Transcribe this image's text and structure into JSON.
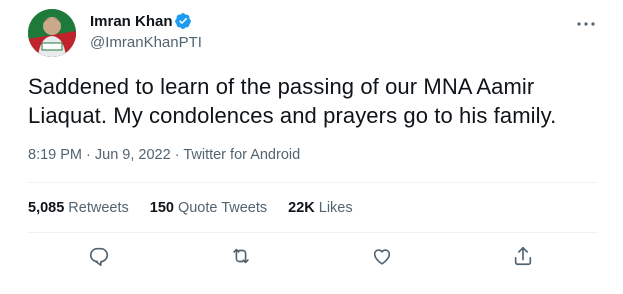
{
  "author": {
    "name": "Imran Khan",
    "handle": "@ImranKhanPTI",
    "verified": true,
    "verified_color": "#1d9bf0"
  },
  "tweet": {
    "text": "Saddened to learn of the passing of our MNA Aamir Liaquat. My condolences and prayers go to his family."
  },
  "meta": {
    "time": "8:19 PM",
    "sep1": " · ",
    "date": "Jun 9, 2022",
    "sep2": " · ",
    "source": "Twitter for Android"
  },
  "stats": {
    "retweets_count": "5,085",
    "retweets_label": "Retweets",
    "quotes_count": "150",
    "quotes_label": "Quote Tweets",
    "likes_count": "22K",
    "likes_label": "Likes"
  },
  "icons": {
    "more": "more-options-icon",
    "reply": "reply-icon",
    "retweet": "retweet-icon",
    "like": "like-icon",
    "share": "share-icon"
  },
  "colors": {
    "text": "#0f1419",
    "secondary": "#536471",
    "divider": "#eff3f4"
  }
}
